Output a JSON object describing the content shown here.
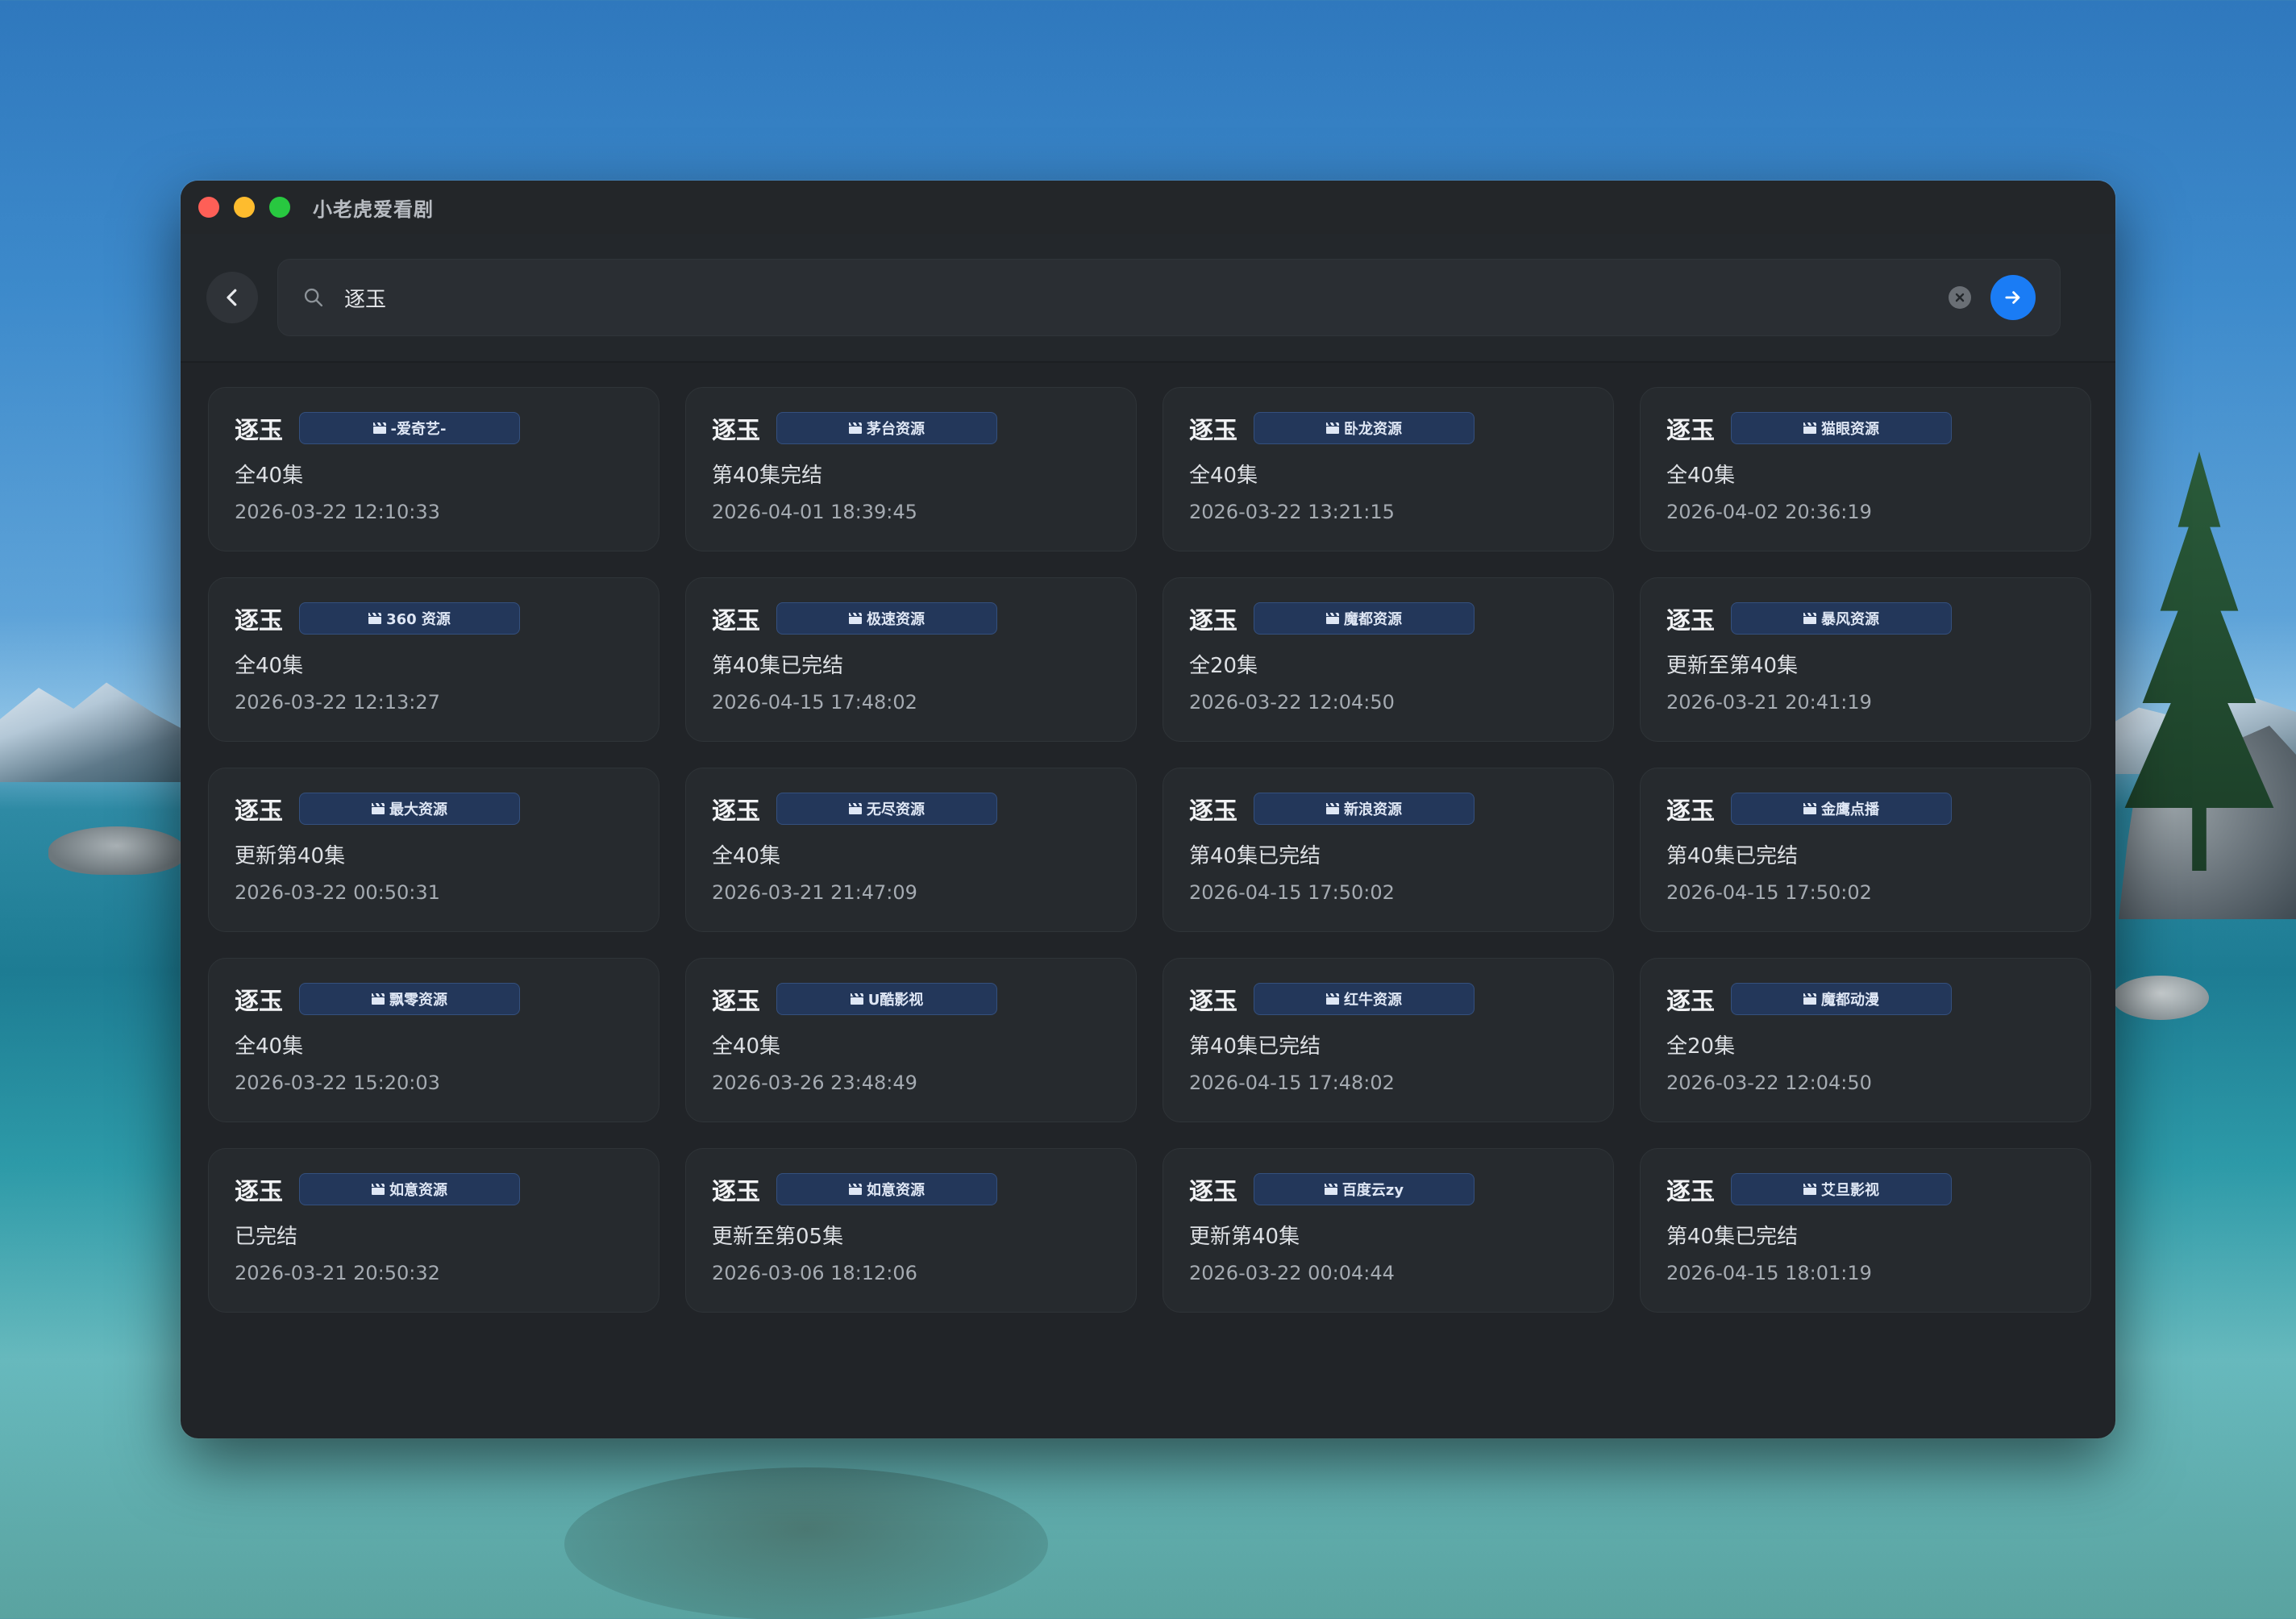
{
  "window": {
    "title": "小老虎爱看剧"
  },
  "search": {
    "value": "逐玉"
  },
  "colors": {
    "accent": "#1a7cf5",
    "badge_bg": "#23375a",
    "window_bg": "#212428"
  },
  "icons": {
    "back": "chevron-left-icon",
    "search": "search-icon",
    "clear": "clear-circle-icon",
    "go": "arrow-right-icon",
    "badge": "clapperboard-icon"
  },
  "results": [
    {
      "title": "逐玉",
      "source": "-爱奇艺-",
      "status": "全40集",
      "time": "2026-03-22 12:10:33"
    },
    {
      "title": "逐玉",
      "source": "茅台资源",
      "status": "第40集完结",
      "time": "2026-04-01 18:39:45"
    },
    {
      "title": "逐玉",
      "source": "卧龙资源",
      "status": "全40集",
      "time": "2026-03-22 13:21:15"
    },
    {
      "title": "逐玉",
      "source": "猫眼资源",
      "status": "全40集",
      "time": "2026-04-02 20:36:19"
    },
    {
      "title": "逐玉",
      "source": "360 资源",
      "status": "全40集",
      "time": "2026-03-22 12:13:27"
    },
    {
      "title": "逐玉",
      "source": "极速资源",
      "status": "第40集已完结",
      "time": "2026-04-15 17:48:02"
    },
    {
      "title": "逐玉",
      "source": "魔都资源",
      "status": "全20集",
      "time": "2026-03-22 12:04:50"
    },
    {
      "title": "逐玉",
      "source": "暴风资源",
      "status": "更新至第40集",
      "time": "2026-03-21 20:41:19"
    },
    {
      "title": "逐玉",
      "source": "最大资源",
      "status": "更新第40集",
      "time": "2026-03-22 00:50:31"
    },
    {
      "title": "逐玉",
      "source": "无尽资源",
      "status": "全40集",
      "time": "2026-03-21 21:47:09"
    },
    {
      "title": "逐玉",
      "source": "新浪资源",
      "status": "第40集已完结",
      "time": "2026-04-15 17:50:02"
    },
    {
      "title": "逐玉",
      "source": "金鹰点播",
      "status": "第40集已完结",
      "time": "2026-04-15 17:50:02"
    },
    {
      "title": "逐玉",
      "source": "飘零资源",
      "status": "全40集",
      "time": "2026-03-22 15:20:03"
    },
    {
      "title": "逐玉",
      "source": "U酷影视",
      "status": "全40集",
      "time": "2026-03-26 23:48:49"
    },
    {
      "title": "逐玉",
      "source": "红牛资源",
      "status": "第40集已完结",
      "time": "2026-04-15 17:48:02"
    },
    {
      "title": "逐玉",
      "source": "魔都动漫",
      "status": "全20集",
      "time": "2026-03-22 12:04:50"
    },
    {
      "title": "逐玉",
      "source": "如意资源",
      "status": "已完结",
      "time": "2026-03-21 20:50:32"
    },
    {
      "title": "逐玉",
      "source": "如意资源",
      "status": "更新至第05集",
      "time": "2026-03-06 18:12:06"
    },
    {
      "title": "逐玉",
      "source": "百度云zy",
      "status": "更新第40集",
      "time": "2026-03-22 00:04:44"
    },
    {
      "title": "逐玉",
      "source": "艾旦影视",
      "status": "第40集已完结",
      "time": "2026-04-15 18:01:19"
    }
  ]
}
